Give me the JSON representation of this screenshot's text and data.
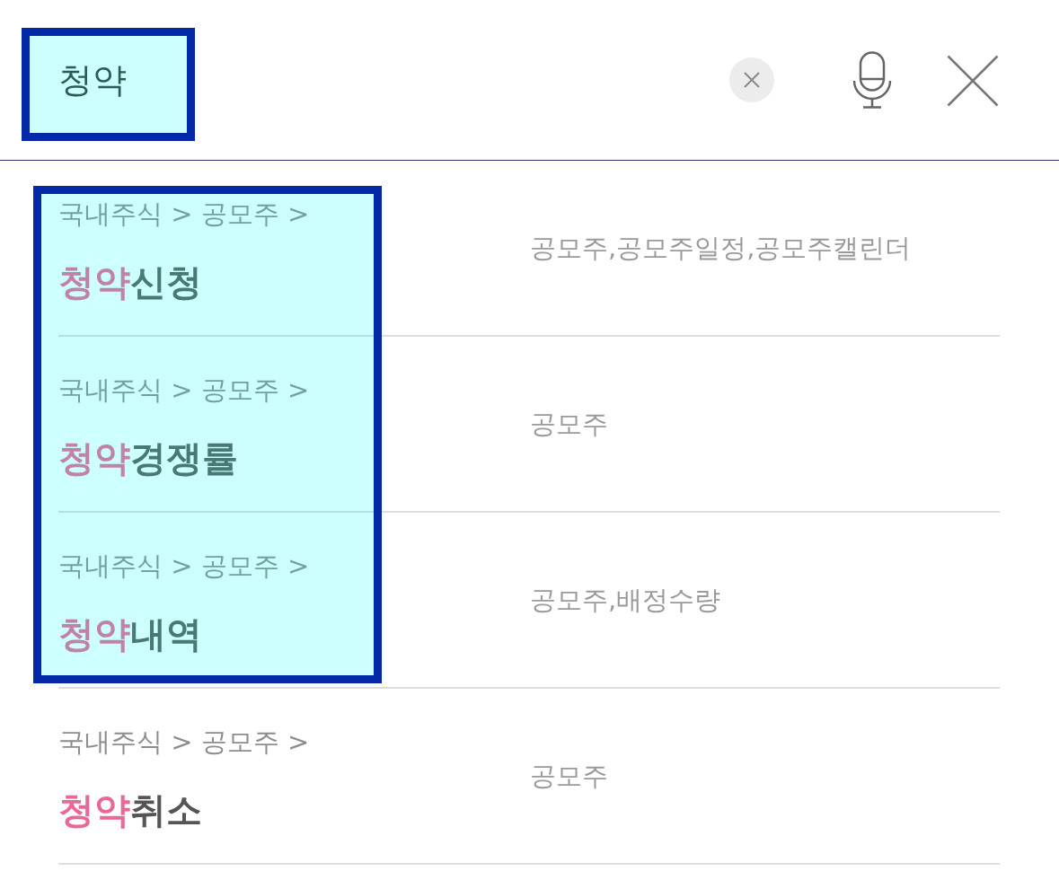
{
  "search": {
    "value": "청약",
    "highlighted": true
  },
  "results": [
    {
      "path": "국내주식 > 공모주 >",
      "match": "청약",
      "rest": "신청",
      "keywords": "공모주,공모주일정,공모주캘린더",
      "highlighted": true
    },
    {
      "path": "국내주식 > 공모주 >",
      "match": "청약",
      "rest": "경쟁률",
      "keywords": "공모주",
      "highlighted": true
    },
    {
      "path": "국내주식 > 공모주 >",
      "match": "청약",
      "rest": "내역",
      "keywords": "공모주,배정수량",
      "highlighted": true
    },
    {
      "path": "국내주식 > 공모주 >",
      "match": "청약",
      "rest": "취소",
      "keywords": "공모주",
      "highlighted": false
    }
  ]
}
